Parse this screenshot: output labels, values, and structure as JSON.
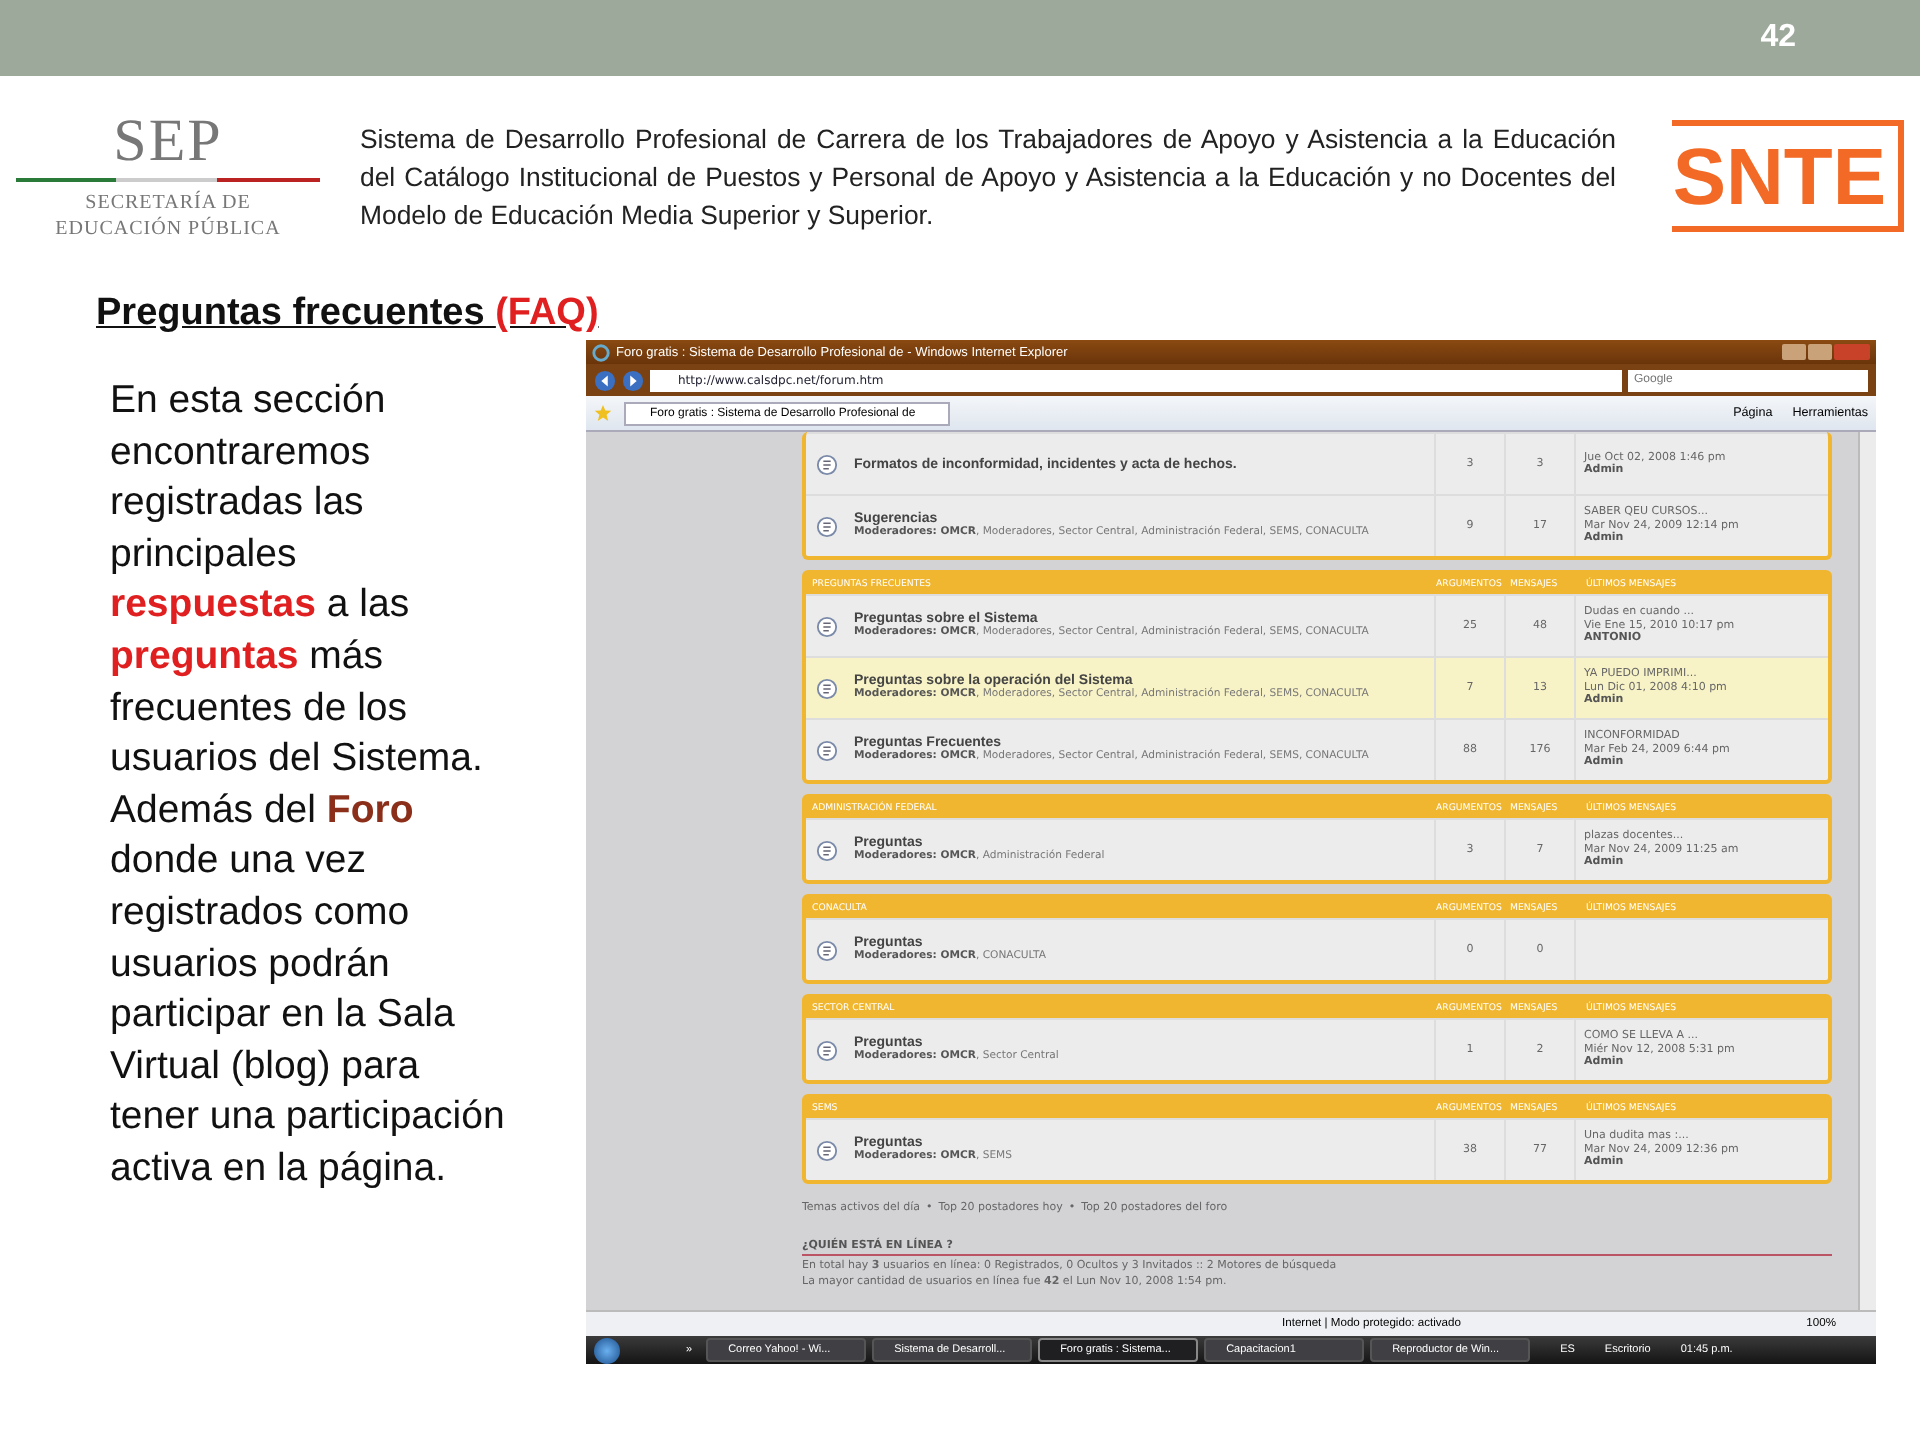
{
  "slide_number": "42",
  "header": {
    "sep_logo": {
      "name": "SEP",
      "line1": "SECRETARÍA DE",
      "line2": "EDUCACIÓN PÚBLICA"
    },
    "description": "Sistema de Desarrollo Profesional de Carrera de los Trabajadores de Apoyo y Asistencia a la Educación  del Catálogo Institucional de Puestos y Personal de Apoyo y Asistencia a la Educación y no Docentes del Modelo de Educación Media Superior y Superior.",
    "snte_logo": "SNTE"
  },
  "title": {
    "text": "Preguntas frecuentes ",
    "accent": "(FAQ)"
  },
  "paragraph": [
    {
      "kind": "plain",
      "text": "En esta sección encontraremos registradas las principales "
    },
    {
      "kind": "red",
      "text": "respuestas"
    },
    {
      "kind": "plain",
      "text": " a las "
    },
    {
      "kind": "red",
      "text": "preguntas"
    },
    {
      "kind": "plain",
      "text": "  más frecuentes de los usuarios del Sistema. Además del "
    },
    {
      "kind": "brown",
      "text": "Foro"
    },
    {
      "kind": "plain",
      "text": " donde una vez registrados como usuarios podrán participar en la Sala Virtual (blog) para tener una participación activa en la página."
    }
  ],
  "browser": {
    "title": "Foro gratis : Sistema de Desarrollo Profesional de - Windows Internet Explorer",
    "address": "http://www.calsdpc.net/forum.htm",
    "search_placeholder": "Google",
    "tab": "Foro gratis : Sistema de Desarrollo Profesional de",
    "toolbar": [
      "Página",
      "Herramientas"
    ],
    "sections": [
      {
        "rows": [
          {
            "title": "Formatos de inconformidad, incidentes y acta de hechos.",
            "topics": "3",
            "messages": "3",
            "last": [
              "Jue Oct 02, 2008 1:46 pm",
              "Admin"
            ],
            "highlighted": false
          },
          {
            "title": "Sugerencias",
            "moderators": "**Moderadores: OMCR**, Moderadores, Sector Central, Administración Federal, SEMS, CONACULTA",
            "topics": "9",
            "messages": "17",
            "last": [
              "SABER QEU CURSOS...",
              "Mar Nov 24, 2009 12:14 pm",
              "Admin"
            ],
            "highlighted": false
          }
        ]
      },
      {
        "title": "PREGUNTAS FRECUENTES",
        "columns": [
          "ARGUMENTOS",
          "MENSAJES",
          "ÚLTIMOS MENSAJES"
        ],
        "rows": [
          {
            "title": "Preguntas sobre el Sistema",
            "moderators": "**Moderadores: OMCR**, Moderadores, Sector Central, Administración Federal, SEMS, CONACULTA",
            "topics": "25",
            "messages": "48",
            "last": [
              "Dudas en cuando ...",
              "Vie Ene 15, 2010 10:17 pm",
              "ANTONIO"
            ],
            "highlighted": false
          },
          {
            "title": "Preguntas sobre la operación del Sistema",
            "moderators": "**Moderadores: OMCR**, Moderadores, Sector Central, Administración Federal, SEMS, CONACULTA",
            "topics": "7",
            "messages": "13",
            "last": [
              "YA PUEDO IMPRIMI...",
              "Lun Dic 01, 2008 4:10 pm",
              "Admin"
            ],
            "highlighted": true
          },
          {
            "title": "Preguntas Frecuentes",
            "moderators": "**Moderadores: OMCR**, Moderadores, Sector Central, Administración Federal, SEMS, CONACULTA",
            "topics": "88",
            "messages": "176",
            "last": [
              "INCONFORMIDAD",
              "Mar Feb 24, 2009 6:44 pm",
              "Admin"
            ],
            "highlighted": false
          }
        ]
      },
      {
        "title": "ADMINISTRACIÓN FEDERAL",
        "columns": [
          "ARGUMENTOS",
          "MENSAJES",
          "ÚLTIMOS MENSAJES"
        ],
        "rows": [
          {
            "title": "Preguntas",
            "moderators": "**Moderadores: OMCR**, Administración Federal",
            "topics": "3",
            "messages": "7",
            "last": [
              "plazas docentes...",
              "Mar Nov 24, 2009 11:25 am",
              "Admin"
            ],
            "highlighted": false
          }
        ]
      },
      {
        "title": "CONACULTA",
        "columns": [
          "ARGUMENTOS",
          "MENSAJES",
          "ÚLTIMOS MENSAJES"
        ],
        "rows": [
          {
            "title": "Preguntas",
            "moderators": "**Moderadores: OMCR**, CONACULTA",
            "topics": "0",
            "messages": "0",
            "last": [],
            "highlighted": false
          }
        ]
      },
      {
        "title": "SECTOR CENTRAL",
        "columns": [
          "ARGUMENTOS",
          "MENSAJES",
          "ÚLTIMOS MENSAJES"
        ],
        "rows": [
          {
            "title": "Preguntas",
            "moderators": "**Moderadores: OMCR**, Sector Central",
            "topics": "1",
            "messages": "2",
            "last": [
              "COMO SE LLEVA A ...",
              "Miér Nov 12, 2008 5:31 pm",
              "Admin"
            ],
            "highlighted": false
          }
        ]
      },
      {
        "title": "SEMS",
        "columns": [
          "ARGUMENTOS",
          "MENSAJES",
          "ÚLTIMOS MENSAJES"
        ],
        "rows": [
          {
            "title": "Preguntas",
            "moderators": "**Moderadores: OMCR**, SEMS",
            "topics": "38",
            "messages": "77",
            "last": [
              "Una dudita mas :...",
              "Mar Nov 24, 2009 12:36 pm",
              "Admin"
            ],
            "highlighted": false
          }
        ]
      }
    ],
    "footer_links": [
      "Temas activos del día",
      "Top 20 postadores hoy",
      "Top 20 postadores del foro"
    ],
    "footer_separator": "•",
    "online": {
      "heading": "¿QUIÉN ESTÁ EN LÍNEA ?",
      "lines": [
        "En total hay **3** usuarios en línea: 0 Registrados, 0 Ocultos y 3 Invitados :: 2 Motores de búsqueda",
        "La mayor cantidad de usuarios en línea fue **42** el Lun Nov 10, 2008 1:54 pm."
      ]
    },
    "status": "Internet | Modo protegido: activado",
    "zoom": "100%",
    "taskbar": {
      "more": "»",
      "tasks": [
        {
          "label": "Correo Yahoo! - Wi...",
          "selected": false
        },
        {
          "label": "Sistema de Desarroll...",
          "selected": false
        },
        {
          "label": "Foro gratis : Sistema...",
          "selected": true
        },
        {
          "label": "Capacitacion1",
          "selected": false
        },
        {
          "label": "Reproductor de Win...",
          "selected": false
        }
      ],
      "language": "ES",
      "desktop": "Escritorio",
      "clock": "01:45 p.m."
    }
  }
}
